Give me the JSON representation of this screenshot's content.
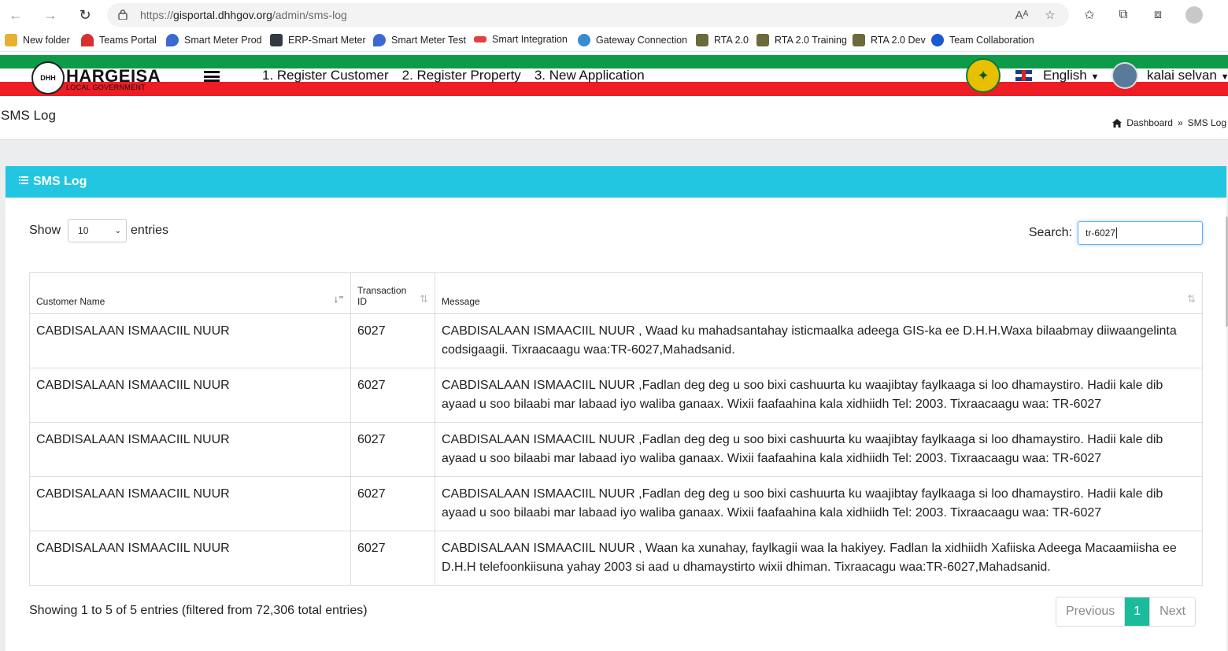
{
  "browser": {
    "url_prefix": "https://",
    "url_host": "gisportal.dhhgov.org",
    "url_path": "/admin/sms-log",
    "read_aloud": "Aᴬ"
  },
  "bookmarks": [
    {
      "label": "New folder",
      "color": "#e8b030"
    },
    {
      "label": "Teams Portal",
      "color": "#d83030"
    },
    {
      "label": "Smart Meter Prod",
      "color": "#3a6ad0"
    },
    {
      "label": "ERP-Smart Meter",
      "color": "#333a44"
    },
    {
      "label": "Smart Meter Test",
      "color": "#3a6ad0"
    },
    {
      "label": "Smart Integration",
      "color": "#e04040"
    },
    {
      "label": "Gateway Connection",
      "color": "#3a8ad0"
    },
    {
      "label": "RTA 2.0",
      "color": "#6a6a3a"
    },
    {
      "label": "RTA 2.0 Training",
      "color": "#6a6a3a"
    },
    {
      "label": "RTA 2.0 Dev",
      "color": "#6a6a3a"
    },
    {
      "label": "Team Collaboration",
      "color": "#1a5ad0"
    }
  ],
  "header": {
    "logo_title": "HARGEISA",
    "logo_sub": "LOCAL GOVERNMENT",
    "logo_mark": "DHH",
    "nav": [
      "1. Register Customer",
      "2. Register Property",
      "3. New Application"
    ],
    "language": "English",
    "user": "kalai selvan",
    "colors": {
      "green": "#0d9a49",
      "red": "#ee1c24",
      "accent": "#23c6e0",
      "pager_active": "#1bbc9b"
    }
  },
  "page": {
    "title": "SMS Log",
    "breadcrumb_home": "Dashboard",
    "breadcrumb_sep": "»",
    "breadcrumb_current": "SMS Log"
  },
  "card": {
    "title": "SMS Log",
    "show_label": "Show",
    "entries_label": "entries",
    "length_value": "10",
    "search_label": "Search:",
    "search_value": "tr-6027"
  },
  "table": {
    "columns": [
      "Customer Name",
      "Transaction ID",
      "Message"
    ],
    "rows": [
      [
        "CABDISALAAN ISMAACIIL NUUR",
        "6027",
        "CABDISALAAN ISMAACIIL NUUR , Waad ku mahadsantahay isticmaalka adeega GIS-ka ee D.H.H.Waxa bilaabmay diiwaangelinta codsigaagii. Tixraacaagu waa:TR-6027,Mahadsanid."
      ],
      [
        "CABDISALAAN ISMAACIIL NUUR",
        "6027",
        "CABDISALAAN ISMAACIIL NUUR ,Fadlan deg deg u soo bixi cashuurta ku waajibtay faylkaaga si loo dhamaystiro. Hadii kale dib ayaad u soo bilaabi mar labaad iyo waliba ganaax. Wixii faafaahina kala xidhiidh Tel: 2003. Tixraacaagu waa: TR-6027"
      ],
      [
        "CABDISALAAN ISMAACIIL NUUR",
        "6027",
        "CABDISALAAN ISMAACIIL NUUR ,Fadlan deg deg u soo bixi cashuurta ku waajibtay faylkaaga si loo dhamaystiro. Hadii kale dib ayaad u soo bilaabi mar labaad iyo waliba ganaax. Wixii faafaahina kala xidhiidh Tel: 2003. Tixraacaagu waa: TR-6027"
      ],
      [
        "CABDISALAAN ISMAACIIL NUUR",
        "6027",
        "CABDISALAAN ISMAACIIL NUUR ,Fadlan deg deg u soo bixi cashuurta ku waajibtay faylkaaga si loo dhamaystiro. Hadii kale dib ayaad u soo bilaabi mar labaad iyo waliba ganaax. Wixii faafaahina kala xidhiidh Tel: 2003. Tixraacaagu waa: TR-6027"
      ],
      [
        "CABDISALAAN ISMAACIIL NUUR",
        "6027",
        "CABDISALAAN ISMAACIIL NUUR , Waan ka xunahay, faylkagii waa la hakiyey. Fadlan la xidhiidh Xafiiska Adeega Macaamiisha ee D.H.H telefoonkiisuna yahay 2003 si aad u dhamaystirto wixii dhiman. Tixraacagu waa:TR-6027,Mahadsanid."
      ]
    ]
  },
  "footer": {
    "info": "Showing 1 to 5 of 5 entries (filtered from 72,306 total entries)",
    "prev": "Previous",
    "page": "1",
    "next": "Next"
  }
}
